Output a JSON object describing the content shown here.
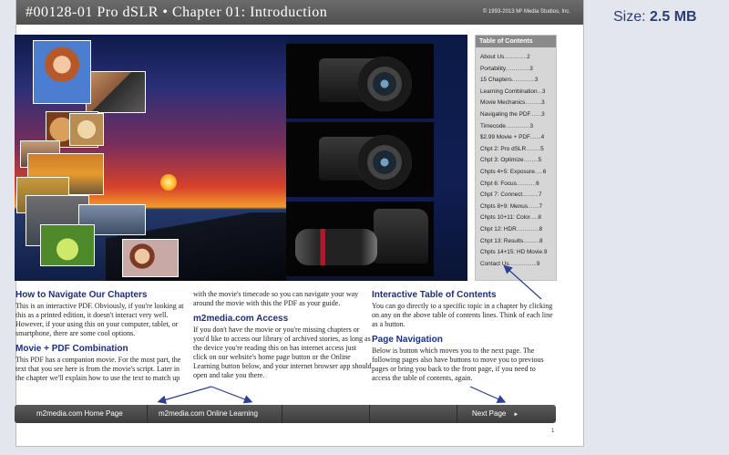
{
  "header": {
    "title": "#00128-01 Pro dSLR • Chapter 01: Introduction",
    "copyright": "© 1993-2013 M² Media Studios, Inc."
  },
  "file_size": {
    "label": "Size:",
    "value": "2.5 MB"
  },
  "toc": {
    "title": "Table of Contents",
    "items": [
      {
        "label": "About Us",
        "dots": "..............",
        "page": "2"
      },
      {
        "label": "Portability",
        "dots": "...............",
        "page": "3"
      },
      {
        "label": "15 Chapters",
        "dots": "..............",
        "page": "3"
      },
      {
        "label": "Learning Combination",
        "dots": "...",
        "page": "3"
      },
      {
        "label": "Movie Mechanics",
        "dots": "..........",
        "page": "3"
      },
      {
        "label": "Navigating the PDF",
        "dots": ".......",
        "page": "3"
      },
      {
        "label": "Timecode",
        "dots": "...............",
        "page": "3"
      },
      {
        "label": "$2.99 Movie + PDF",
        "dots": ".......",
        "page": "4"
      },
      {
        "label": "Chpt 2: Pro dSLR",
        "dots": ".........",
        "page": "5"
      },
      {
        "label": "Chpt 3: Optimize",
        "dots": ".........",
        "page": "5"
      },
      {
        "label": "Chpts 4+5: Exposure",
        "dots": ".....",
        "page": "6"
      },
      {
        "label": "Chpt 6: Focus",
        "dots": "............",
        "page": "6"
      },
      {
        "label": "Chpt 7: Connect",
        "dots": "..........",
        "page": "7"
      },
      {
        "label": "Chpts 8+9: Menus",
        "dots": ".......",
        "page": "7"
      },
      {
        "label": "Chpts 10+11: Color",
        "dots": ".....",
        "page": "8"
      },
      {
        "label": "Chpt 12: HDR",
        "dots": "..............",
        "page": "8"
      },
      {
        "label": "Chpt 13: Results",
        "dots": "..........",
        "page": "8"
      },
      {
        "label": "Chpts 14+15: HD Movie",
        "dots": ".",
        "page": "9"
      },
      {
        "label": "Contact Us",
        "dots": ".................",
        "page": "9"
      }
    ]
  },
  "sections": {
    "navigate": {
      "heading": "How to Navigate Our Chapters",
      "body": "This is an interactive PDF. Obviously, if you're looking at this as a printed edition, it doesn't interact very well. However, if your using this on your computer, tablet, or smartphone, there are some cool options."
    },
    "combination": {
      "heading": "Movie + PDF Combination",
      "body": "This PDF has a companion movie. For the most part, the text that you see here is from the movie's script. Later in the chapter we'll explain how to use the text to match up"
    },
    "combination_cont": {
      "body": "with the movie's timecode so you can navigate your way around the movie with this the PDF as your guide."
    },
    "access": {
      "heading": "m2media.com Access",
      "body": "If you don't have the movie or you're missing chapters or you'd like to access our library of archived stories, as long as the device you're reading this on has internet access just click on our website's home page button or the Online Learning button below, and your internet browser app should open and take you there."
    },
    "toc_help": {
      "heading": "Interactive Table of Contents",
      "body": "You can go directly to a specific topic in a chapter by clicking on any on the above table of contents lines. Think of each line as a button."
    },
    "page_nav": {
      "heading": "Page Navigation",
      "body": "Below is button which moves you to the next page. The following pages also have buttons to move you to previous pages or bring you back to the front page, if you need to access the table of contents, again."
    }
  },
  "navbar": {
    "home": "m2media.com  Home Page",
    "learning": "m2media.com  Online Learning",
    "next": "Next Page",
    "next_icon": "►"
  },
  "page_number": "1",
  "colors": {
    "heading": "#1c2e86",
    "arrow": "#2a3f9a",
    "titlebar": "#5a5a5a",
    "size_label": "#2a3f73"
  }
}
